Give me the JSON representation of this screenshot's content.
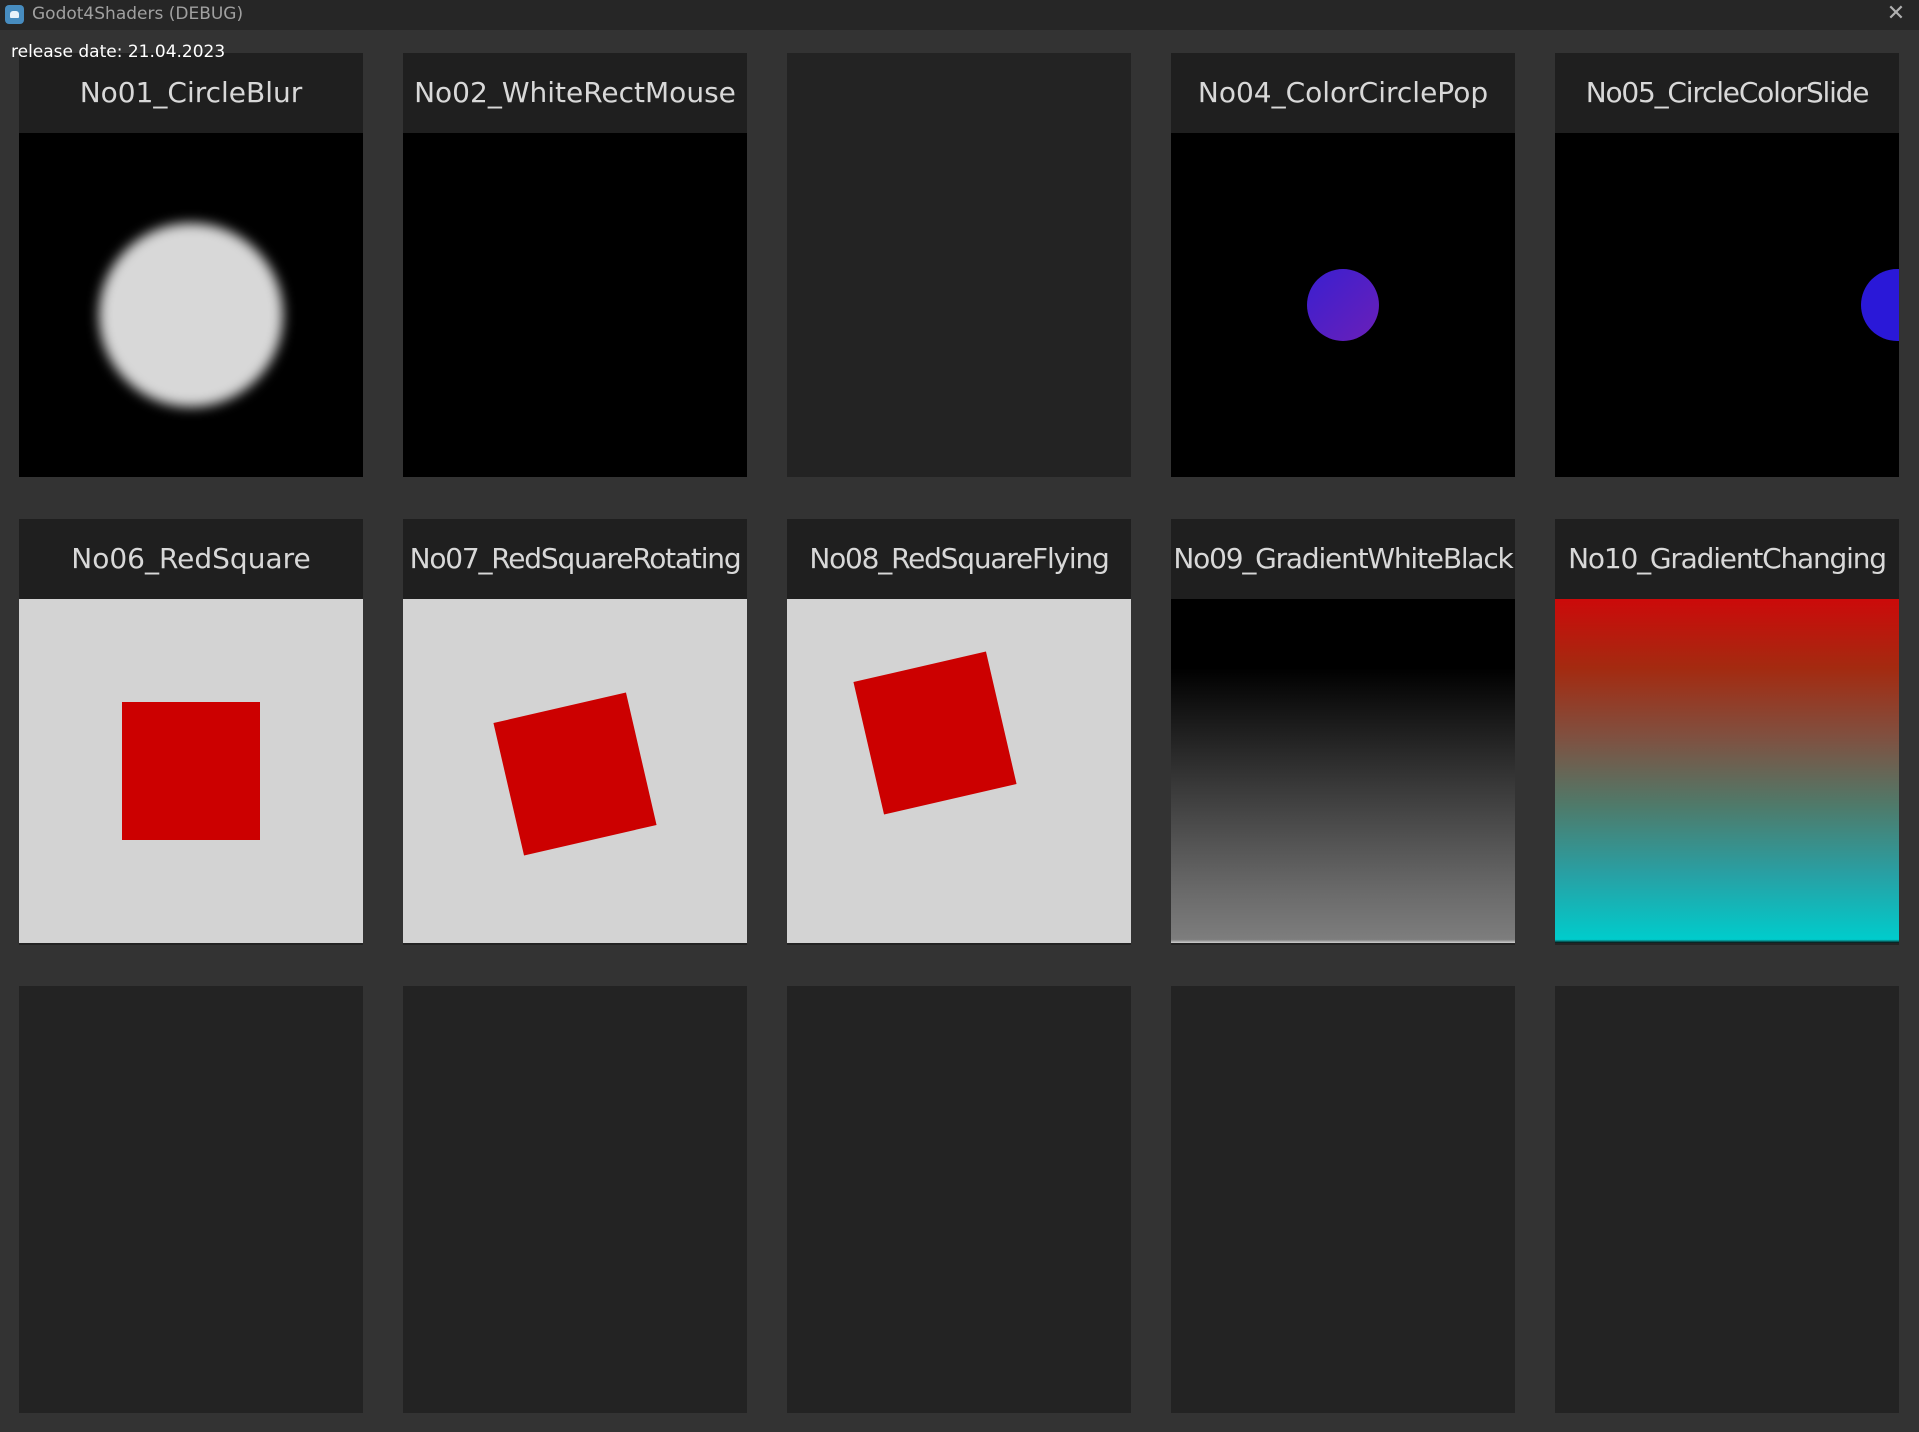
{
  "window": {
    "title": "Godot4Shaders (DEBUG)",
    "icon": "godot-icon",
    "close_icon": "close-icon",
    "close_glyph": "✕"
  },
  "release_label": "release date: 21.04.2023",
  "cards": [
    {
      "title": "No01_CircleBlur"
    },
    {
      "title": "No02_WhiteRectMouse"
    },
    {
      "title": ""
    },
    {
      "title": "No04_ColorCirclePop"
    },
    {
      "title": "No05_CircleColorSlide"
    },
    {
      "title": "No06_RedSquare"
    },
    {
      "title": "No07_RedSquareRotating"
    },
    {
      "title": "No08_RedSquareFlying"
    },
    {
      "title": "No09_GradientWhiteBlack"
    },
    {
      "title": "No10_GradientChanging"
    }
  ],
  "colors": {
    "background": "#333333",
    "card": "#232323",
    "red": "#cc0000",
    "light_grey": "#d3d3d3",
    "blue_circle": "#2a18d8",
    "cyan": "#00cccc"
  }
}
